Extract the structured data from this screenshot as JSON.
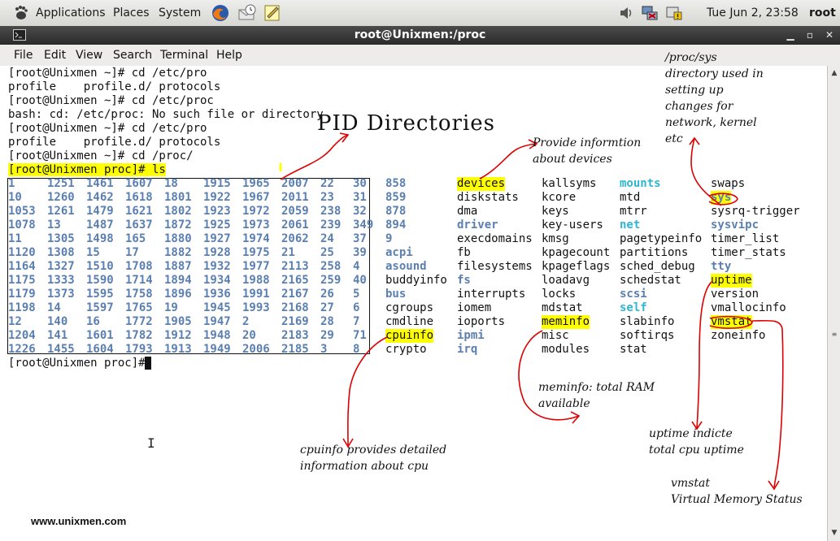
{
  "panel": {
    "applications": "Applications",
    "places": "Places",
    "system": "System",
    "datetime": "Tue Jun  2, 23:58",
    "user": "root",
    "icons": [
      "gnome-foot-icon",
      "firefox-icon",
      "mail-clock-icon",
      "text-editor-icon",
      "volume-icon",
      "network-icon",
      "update-notifier-icon"
    ]
  },
  "window": {
    "title": "root@Unixmen:/proc",
    "menu": [
      "File",
      "Edit",
      "View",
      "Search",
      "Terminal",
      "Help"
    ]
  },
  "terminal": {
    "lines": [
      "[root@Unixmen ~]# cd /etc/pro",
      "profile    profile.d/ protocols",
      "[root@Unixmen ~]# cd /etc/proc",
      "bash: cd: /etc/proc: No such file or directory",
      "[root@Unixmen ~]# cd /etc/pro",
      "profile    profile.d/ protocols",
      "[root@Unixmen ~]# cd /proc/",
      "[root@Unixmen proc]# ls"
    ],
    "last_prompt": "[root@Unixmen proc]# ",
    "pid_rows": [
      [
        "1",
        "1251",
        "1461",
        "1607",
        "18",
        "1915",
        "1965",
        "2007",
        "22",
        "30"
      ],
      [
        "10",
        "1260",
        "1462",
        "1618",
        "1801",
        "1922",
        "1967",
        "2011",
        "23",
        "31"
      ],
      [
        "1053",
        "1261",
        "1479",
        "1621",
        "1802",
        "1923",
        "1972",
        "2059",
        "238",
        "32"
      ],
      [
        "1078",
        "13",
        "1487",
        "1637",
        "1872",
        "1925",
        "1973",
        "2061",
        "239",
        "349"
      ],
      [
        "11",
        "1305",
        "1498",
        "165",
        "1880",
        "1927",
        "1974",
        "2062",
        "24",
        "37"
      ],
      [
        "1120",
        "1308",
        "15",
        "17",
        "1882",
        "1928",
        "1975",
        "21",
        "25",
        "39"
      ],
      [
        "1164",
        "1327",
        "1510",
        "1708",
        "1887",
        "1932",
        "1977",
        "2113",
        "258",
        "4"
      ],
      [
        "1175",
        "1333",
        "1590",
        "1714",
        "1894",
        "1934",
        "1988",
        "2165",
        "259",
        "40"
      ],
      [
        "1179",
        "1373",
        "1595",
        "1758",
        "1896",
        "1936",
        "1991",
        "2167",
        "26",
        "5"
      ],
      [
        "1198",
        "14",
        "1597",
        "1765",
        "19",
        "1945",
        "1993",
        "2168",
        "27",
        "6"
      ],
      [
        "12",
        "140",
        "16",
        "1772",
        "1905",
        "1947",
        "2",
        "2169",
        "28",
        "7"
      ],
      [
        "1204",
        "141",
        "1601",
        "1782",
        "1912",
        "1948",
        "20",
        "2183",
        "29",
        "71"
      ],
      [
        "1226",
        "1455",
        "1604",
        "1793",
        "1913",
        "1949",
        "2006",
        "2185",
        "3",
        "8"
      ]
    ],
    "columns": [
      [
        {
          "t": "858",
          "c": "dir"
        },
        {
          "t": "859",
          "c": "dir"
        },
        {
          "t": "878",
          "c": "dir"
        },
        {
          "t": "894",
          "c": "dir"
        },
        {
          "t": "9",
          "c": "dir"
        },
        {
          "t": "acpi",
          "c": "dir"
        },
        {
          "t": "asound",
          "c": "dir"
        },
        {
          "t": "buddyinfo",
          "c": "file"
        },
        {
          "t": "bus",
          "c": "dir"
        },
        {
          "t": "cgroups",
          "c": "file"
        },
        {
          "t": "cmdline",
          "c": "file"
        },
        {
          "t": "cpuinfo",
          "c": "file",
          "h": true
        },
        {
          "t": "crypto",
          "c": "file"
        }
      ],
      [
        {
          "t": "devices",
          "c": "file",
          "h": true
        },
        {
          "t": "diskstats",
          "c": "file"
        },
        {
          "t": "dma",
          "c": "file"
        },
        {
          "t": "driver",
          "c": "dir"
        },
        {
          "t": "execdomains",
          "c": "file"
        },
        {
          "t": "fb",
          "c": "file"
        },
        {
          "t": "filesystems",
          "c": "file"
        },
        {
          "t": "fs",
          "c": "dir"
        },
        {
          "t": "interrupts",
          "c": "file"
        },
        {
          "t": "iomem",
          "c": "file"
        },
        {
          "t": "ioports",
          "c": "file"
        },
        {
          "t": "ipmi",
          "c": "dir"
        },
        {
          "t": "irq",
          "c": "dir"
        }
      ],
      [
        {
          "t": "kallsyms",
          "c": "file"
        },
        {
          "t": "kcore",
          "c": "file"
        },
        {
          "t": "keys",
          "c": "file"
        },
        {
          "t": "key-users",
          "c": "file"
        },
        {
          "t": "kmsg",
          "c": "file"
        },
        {
          "t": "kpagecount",
          "c": "file"
        },
        {
          "t": "kpageflags",
          "c": "file"
        },
        {
          "t": "loadavg",
          "c": "file"
        },
        {
          "t": "locks",
          "c": "file"
        },
        {
          "t": "mdstat",
          "c": "file"
        },
        {
          "t": "meminfo",
          "c": "file",
          "h": true
        },
        {
          "t": "misc",
          "c": "file"
        },
        {
          "t": "modules",
          "c": "file"
        }
      ],
      [
        {
          "t": "mounts",
          "c": "cyan"
        },
        {
          "t": "mtd",
          "c": "file"
        },
        {
          "t": "mtrr",
          "c": "file"
        },
        {
          "t": "net",
          "c": "cyan"
        },
        {
          "t": "pagetypeinfo",
          "c": "file"
        },
        {
          "t": "partitions",
          "c": "file"
        },
        {
          "t": "sched_debug",
          "c": "file"
        },
        {
          "t": "schedstat",
          "c": "file"
        },
        {
          "t": "scsi",
          "c": "dir"
        },
        {
          "t": "self",
          "c": "cyan"
        },
        {
          "t": "slabinfo",
          "c": "file"
        },
        {
          "t": "softirqs",
          "c": "file"
        },
        {
          "t": "stat",
          "c": "file"
        }
      ],
      [
        {
          "t": "swaps",
          "c": "file"
        },
        {
          "t": "sys",
          "c": "dir",
          "h": true
        },
        {
          "t": "sysrq-trigger",
          "c": "file"
        },
        {
          "t": "sysvipc",
          "c": "dir"
        },
        {
          "t": "timer_list",
          "c": "file"
        },
        {
          "t": "timer_stats",
          "c": "file"
        },
        {
          "t": "tty",
          "c": "dir"
        },
        {
          "t": "uptime",
          "c": "file",
          "h": true
        },
        {
          "t": "version",
          "c": "file"
        },
        {
          "t": "vmallocinfo",
          "c": "file"
        },
        {
          "t": "vmstat",
          "c": "file",
          "h": true
        },
        {
          "t": "zoneinfo",
          "c": "file"
        }
      ]
    ]
  },
  "annotations": {
    "pid": "PID Directories",
    "devices": "Provide informtion\nabout devices",
    "sys": "/proc/sys\ndirectory used in\nsetting up\nchanges for\nnetwork, kernel\netc",
    "meminfo": "meminfo: total RAM\navailable",
    "cpuinfo": "cpuinfo provides detailed\ninformation about cpu",
    "uptime": "uptime indicte\ntotal cpu uptime",
    "vmstat": "vmstat\nVirtual Memory Status",
    "pen_color": "#e00000"
  },
  "watermark": "www.unixmen.com"
}
